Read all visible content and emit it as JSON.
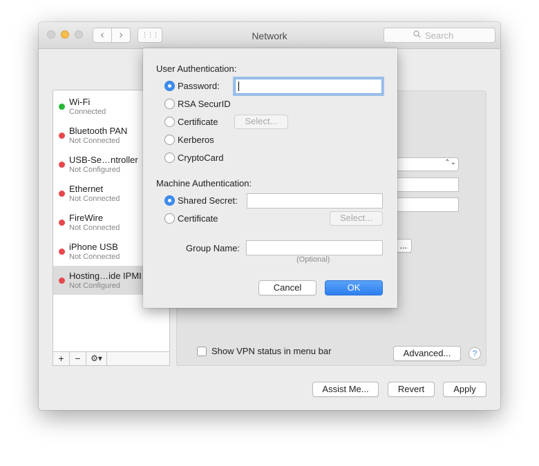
{
  "window": {
    "title": "Network",
    "search_placeholder": "Search",
    "nav_back": "‹",
    "nav_forward": "›",
    "nav_grid": "⋮⋮⋮"
  },
  "services": [
    {
      "name": "Wi-Fi",
      "status": "Connected",
      "status_color": "#29b536"
    },
    {
      "name": "Bluetooth PAN",
      "status": "Not Connected",
      "status_color": "#e5484d"
    },
    {
      "name": "USB-Se…ntroller",
      "status": "Not Configured",
      "status_color": "#e5484d"
    },
    {
      "name": "Ethernet",
      "status": "Not Connected",
      "status_color": "#e5484d"
    },
    {
      "name": "FireWire",
      "status": "Not Connected",
      "status_color": "#e5484d"
    },
    {
      "name": "iPhone USB",
      "status": "Not Connected",
      "status_color": "#e5484d"
    },
    {
      "name": "Hosting…ide IPMI",
      "status": "Not Configured",
      "status_color": "#e5484d",
      "selected": true
    }
  ],
  "sidebar_footer": {
    "add": "+",
    "remove": "−",
    "gear": "⚙▾"
  },
  "content": {
    "show_vpn_label": "Show VPN status in menu bar",
    "show_vpn_checked": false,
    "advanced_button": "Advanced...",
    "help_button": "?",
    "partial_button": "...",
    "popup_chevron": "⌃⌄"
  },
  "footer": {
    "assist_button": "Assist Me...",
    "revert_button": "Revert",
    "apply_button": "Apply"
  },
  "sheet": {
    "user_auth_label": "User Authentication:",
    "user_options": [
      {
        "label": "Password:",
        "selected": true
      },
      {
        "label": "RSA SecurID",
        "selected": false
      },
      {
        "label": "Certificate",
        "selected": false
      },
      {
        "label": "Kerberos",
        "selected": false
      },
      {
        "label": "CryptoCard",
        "selected": false
      }
    ],
    "password_value": "",
    "user_cert_select": "Select...",
    "machine_auth_label": "Machine Authentication:",
    "machine_options": [
      {
        "label": "Shared Secret:",
        "selected": true
      },
      {
        "label": "Certificate",
        "selected": false
      }
    ],
    "shared_secret_value": "",
    "machine_cert_select": "Select...",
    "group_name_label": "Group Name:",
    "group_name_value": "",
    "group_optional": "(Optional)",
    "cancel_button": "Cancel",
    "ok_button": "OK",
    "accent_color": "#3f8ef0"
  }
}
